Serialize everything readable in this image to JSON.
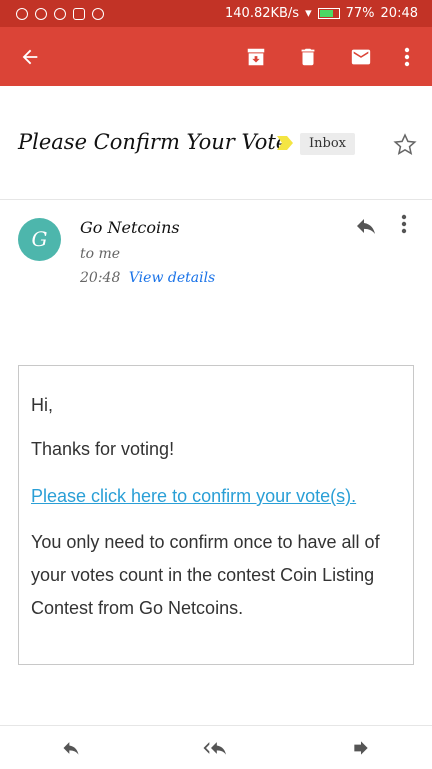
{
  "status_bar": {
    "net_speed": "140.82KB/s",
    "battery": "77%",
    "battery_level": 0.77,
    "time": "20:48"
  },
  "toolbar": {
    "icons": [
      "back-arrow-icon",
      "archive-icon",
      "delete-icon",
      "mark-unread-icon",
      "more-vert-icon"
    ]
  },
  "message": {
    "subject": "Please Confirm Your Vote",
    "label": "Inbox",
    "sender": {
      "initial": "G",
      "name": "Go Netcoins",
      "to": "to me",
      "time": "20:48",
      "details_link": "View details"
    },
    "body": {
      "greeting": "Hi,",
      "thanks": "Thanks for voting!",
      "confirm_link": "Please click here to confirm your vote(s).",
      "note": "You only need to confirm once to have all of your votes count in the contest Coin Listing Contest from Go Netcoins."
    }
  },
  "bottom_actions": [
    "reply-icon",
    "reply-all-icon",
    "forward-icon"
  ],
  "colors": {
    "status_bar": "#c23326",
    "toolbar": "#db4437",
    "avatar": "#4db6ac",
    "link": "#2a9fd6",
    "label_marker": "#f4e542"
  }
}
